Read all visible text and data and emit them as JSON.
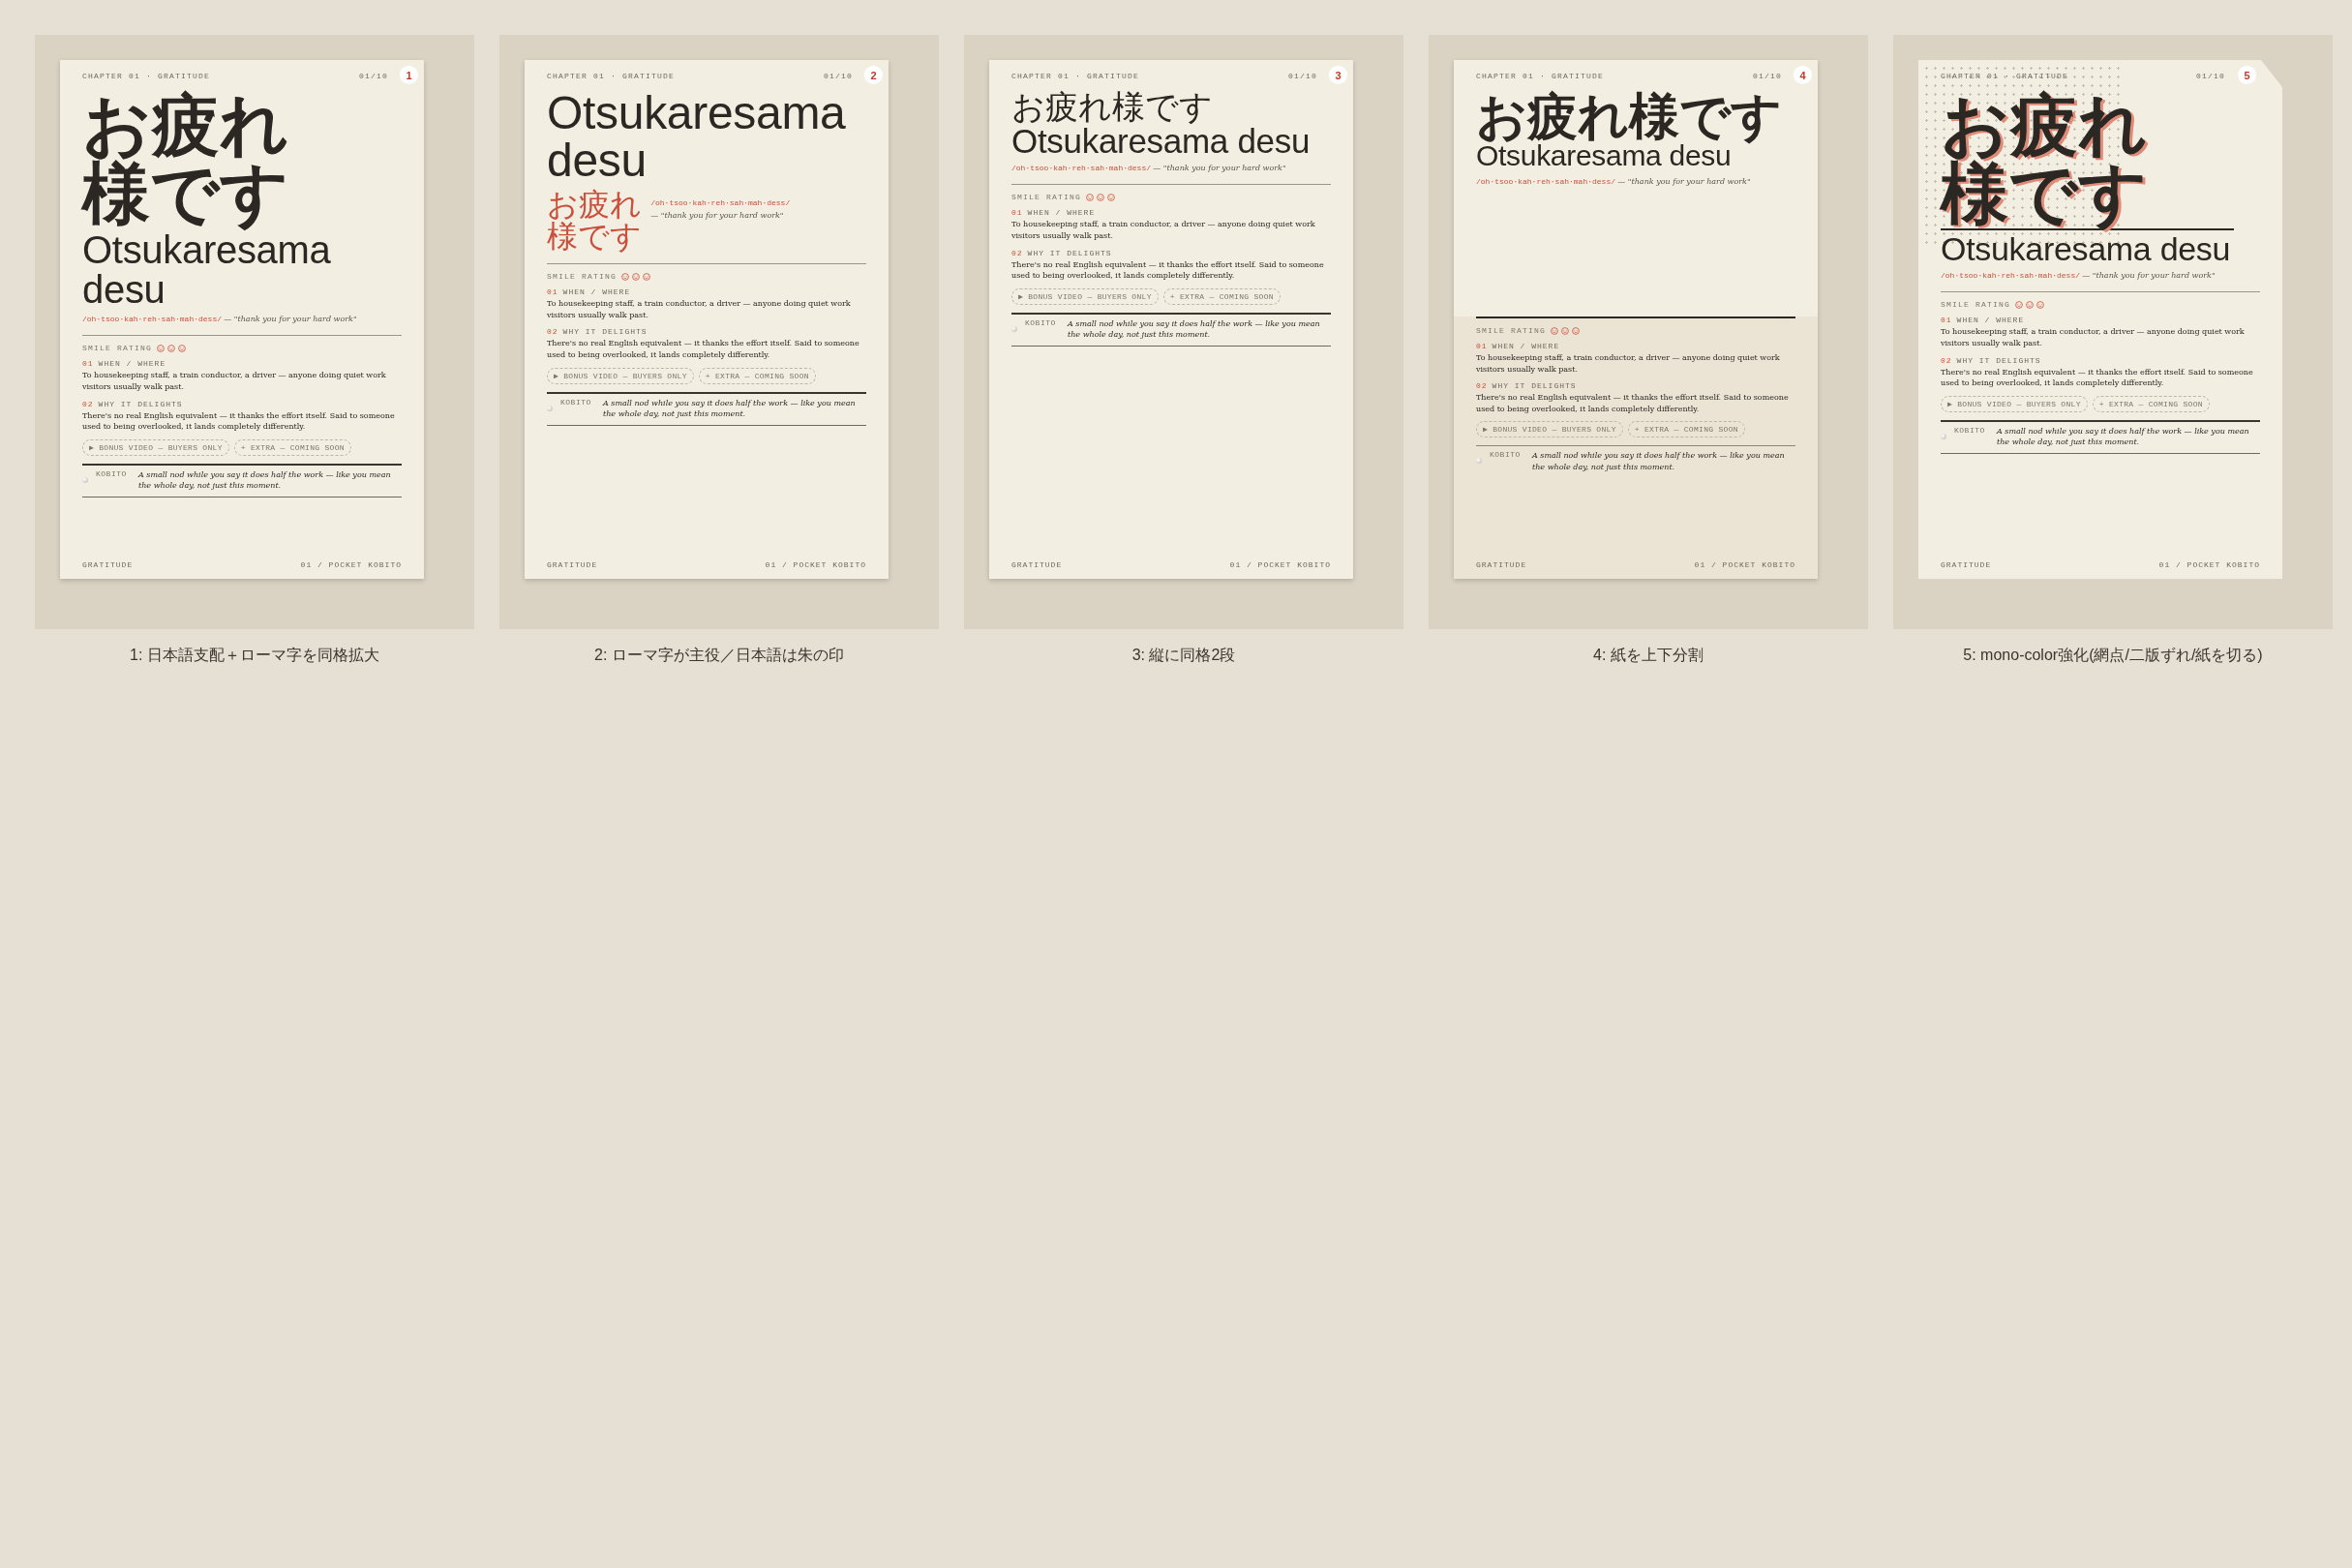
{
  "variants": [
    {
      "number": "1",
      "kind": "jp-dominant",
      "chapter": "CHAPTER 01 · GRATITUDE",
      "page": "01/10",
      "japanese": "お疲れ様です",
      "romaji": "Otsukaresama desu",
      "pronunciation": "/oh·tsoo·kah·reh·sah·mah·dess/",
      "gloss": "— \"thank you for your hard work\"",
      "rating_label": "SMILE RATING",
      "sections": [
        {
          "number": "01",
          "label": "WHEN / WHERE",
          "body": "To housekeeping staff, a train conductor, a driver — anyone doing quiet work visitors usually walk past."
        },
        {
          "number": "02",
          "label": "WHY IT DELIGHTS",
          "body": "There's no real English equivalent — it thanks the effort itself. Said to someone used to being overlooked, it lands completely differently."
        }
      ],
      "chips": [
        "▶ BONUS VIDEO — BUYERS ONLY",
        "+ EXTRA — COMING SOON"
      ],
      "note": {
        "author": "KOBITO",
        "text": "A small nod while you say it does half the work — like you mean the whole day, not just this moment."
      },
      "footer_left": "GRATITUDE",
      "footer_right": "01 / POCKET KOBITO",
      "caption": "1: 日本語支配＋ローマ字を同格拡大"
    },
    {
      "number": "2",
      "kind": "romaji-lead",
      "chapter": "CHAPTER 01 · GRATITUDE",
      "page": "01/10",
      "japanese": "お疲れ様です",
      "romaji": "Otsukaresama desu",
      "pronunciation": "/oh·tsoo·kah·reh·sah·mah·dess/",
      "gloss": "— \"thank you for your hard work\"",
      "rating_label": "SMILE RATING",
      "sections": [
        {
          "number": "01",
          "label": "WHEN / WHERE",
          "body": "To housekeeping staff, a train conductor, a driver — anyone doing quiet work visitors usually walk past."
        },
        {
          "number": "02",
          "label": "WHY IT DELIGHTS",
          "body": "There's no real English equivalent — it thanks the effort itself. Said to someone used to being overlooked, it lands completely differently."
        }
      ],
      "chips": [
        "▶ BONUS VIDEO — BUYERS ONLY",
        "+ EXTRA — COMING SOON"
      ],
      "note": {
        "author": "KOBITO",
        "text": "A small nod while you say it does half the work — like you mean the whole day, not just this moment."
      },
      "footer_left": "GRATITUDE",
      "footer_right": "01 / POCKET KOBITO",
      "caption": "2: ローマ字が主役／日本語は朱の印"
    },
    {
      "number": "3",
      "kind": "stacked",
      "chapter": "CHAPTER 01 · GRATITUDE",
      "page": "01/10",
      "japanese": "お疲れ様です",
      "romaji": "Otsukaresama desu",
      "pronunciation": "/oh·tsoo·kah·reh·sah·mah·dess/",
      "gloss": "— \"thank you for your hard work\"",
      "rating_label": "SMILE RATING",
      "sections": [
        {
          "number": "01",
          "label": "WHEN / WHERE",
          "body": "To housekeeping staff, a train conductor, a driver — anyone doing quiet work visitors usually walk past."
        },
        {
          "number": "02",
          "label": "WHY IT DELIGHTS",
          "body": "There's no real English equivalent — it thanks the effort itself. Said to someone used to being overlooked, it lands completely differently."
        }
      ],
      "chips": [
        "▶ BONUS VIDEO — BUYERS ONLY",
        "+ EXTRA — COMING SOON"
      ],
      "note": {
        "author": "KOBITO",
        "text": "A small nod while you say it does half the work — like you mean the whole day, not just this moment."
      },
      "footer_left": "GRATITUDE",
      "footer_right": "01 / POCKET KOBITO",
      "caption": "3: 縦に同格2段"
    },
    {
      "number": "4",
      "kind": "split",
      "chapter": "CHAPTER 01 · GRATITUDE",
      "page": "01/10",
      "japanese": "お疲れ様です",
      "romaji": "Otsukaresama desu",
      "pronunciation": "/oh·tsoo·kah·reh·sah·mah·dess/",
      "gloss": "— \"thank you for your hard work\"",
      "rating_label": "SMILE RATING",
      "sections": [
        {
          "number": "01",
          "label": "WHEN / WHERE",
          "body": "To housekeeping staff, a train conductor, a driver — anyone doing quiet work visitors usually walk past."
        },
        {
          "number": "02",
          "label": "WHY IT DELIGHTS",
          "body": "There's no real English equivalent — it thanks the effort itself. Said to someone used to being overlooked, it lands completely differently."
        }
      ],
      "chips": [
        "▶ BONUS VIDEO — BUYERS ONLY",
        "+ EXTRA — COMING SOON"
      ],
      "note": {
        "author": "KOBITO",
        "text": "A small nod while you say it does half the work — like you mean the whole day, not just this moment."
      },
      "footer_left": "GRATITUDE",
      "footer_right": "01 / POCKET KOBITO",
      "caption": "4: 紙を上下分割"
    },
    {
      "number": "5",
      "kind": "mono-color",
      "chapter": "CHAPTER 01 · GRATITUDE",
      "page": "01/10",
      "japanese": "お疲れ様です",
      "romaji": "Otsukaresama desu",
      "pronunciation": "/oh·tsoo·kah·reh·sah·mah·dess/",
      "gloss": "— \"thank you for your hard work\"",
      "rating_label": "SMILE RATING",
      "sections": [
        {
          "number": "01",
          "label": "WHEN / WHERE",
          "body": "To housekeeping staff, a train conductor, a driver — anyone doing quiet work visitors usually walk past."
        },
        {
          "number": "02",
          "label": "WHY IT DELIGHTS",
          "body": "There's no real English equivalent — it thanks the effort itself. Said to someone used to being overlooked, it lands completely differently."
        }
      ],
      "chips": [
        "▶ BONUS VIDEO — BUYERS ONLY",
        "+ EXTRA — COMING SOON"
      ],
      "note": {
        "author": "KOBITO",
        "text": "A small nod while you say it does half the work — like you mean the whole day, not just this moment."
      },
      "footer_left": "GRATITUDE",
      "footer_right": "01 / POCKET KOBITO",
      "caption": "5: mono-color強化(網点/二版ずれ/紙を切る)"
    }
  ]
}
